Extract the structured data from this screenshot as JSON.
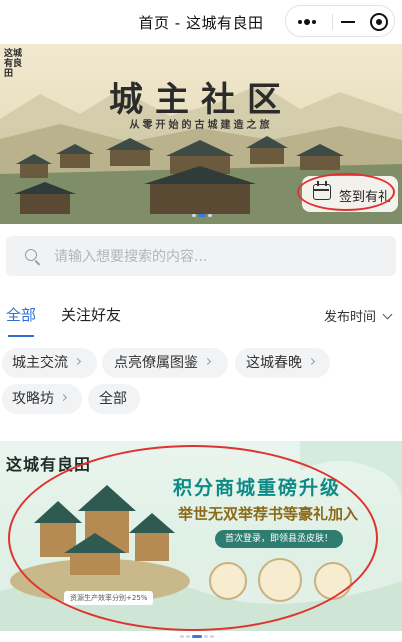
{
  "nav": {
    "title": "首页 - 这城有良田"
  },
  "banner": {
    "logo_text": "这城有良田",
    "title": "城主社区",
    "subtitle": "从零开始的古城建造之旅",
    "checkin_label": "签到有礼"
  },
  "search": {
    "placeholder": "请输入想要搜索的内容..."
  },
  "tabs": {
    "all": "全部",
    "following": "关注好友",
    "sort_label": "发布时间"
  },
  "chips": [
    {
      "label": "城主交流"
    },
    {
      "label": "点亮僚属图鉴"
    },
    {
      "label": "这城春晚"
    },
    {
      "label": "攻略坊"
    },
    {
      "label": "全部"
    }
  ],
  "promo": {
    "logo_text": "这城有良田",
    "headline": "积分商城重磅升级",
    "subheadline": "举世无双举荐书等豪礼加入",
    "pill": "首次登录，即领县丞皮肤！",
    "note": "资源生产效率分别+25%"
  },
  "colors": {
    "accent": "#2f6fd6",
    "highlight_ring": "#e0322f",
    "promo_teal": "#0d8a86"
  }
}
